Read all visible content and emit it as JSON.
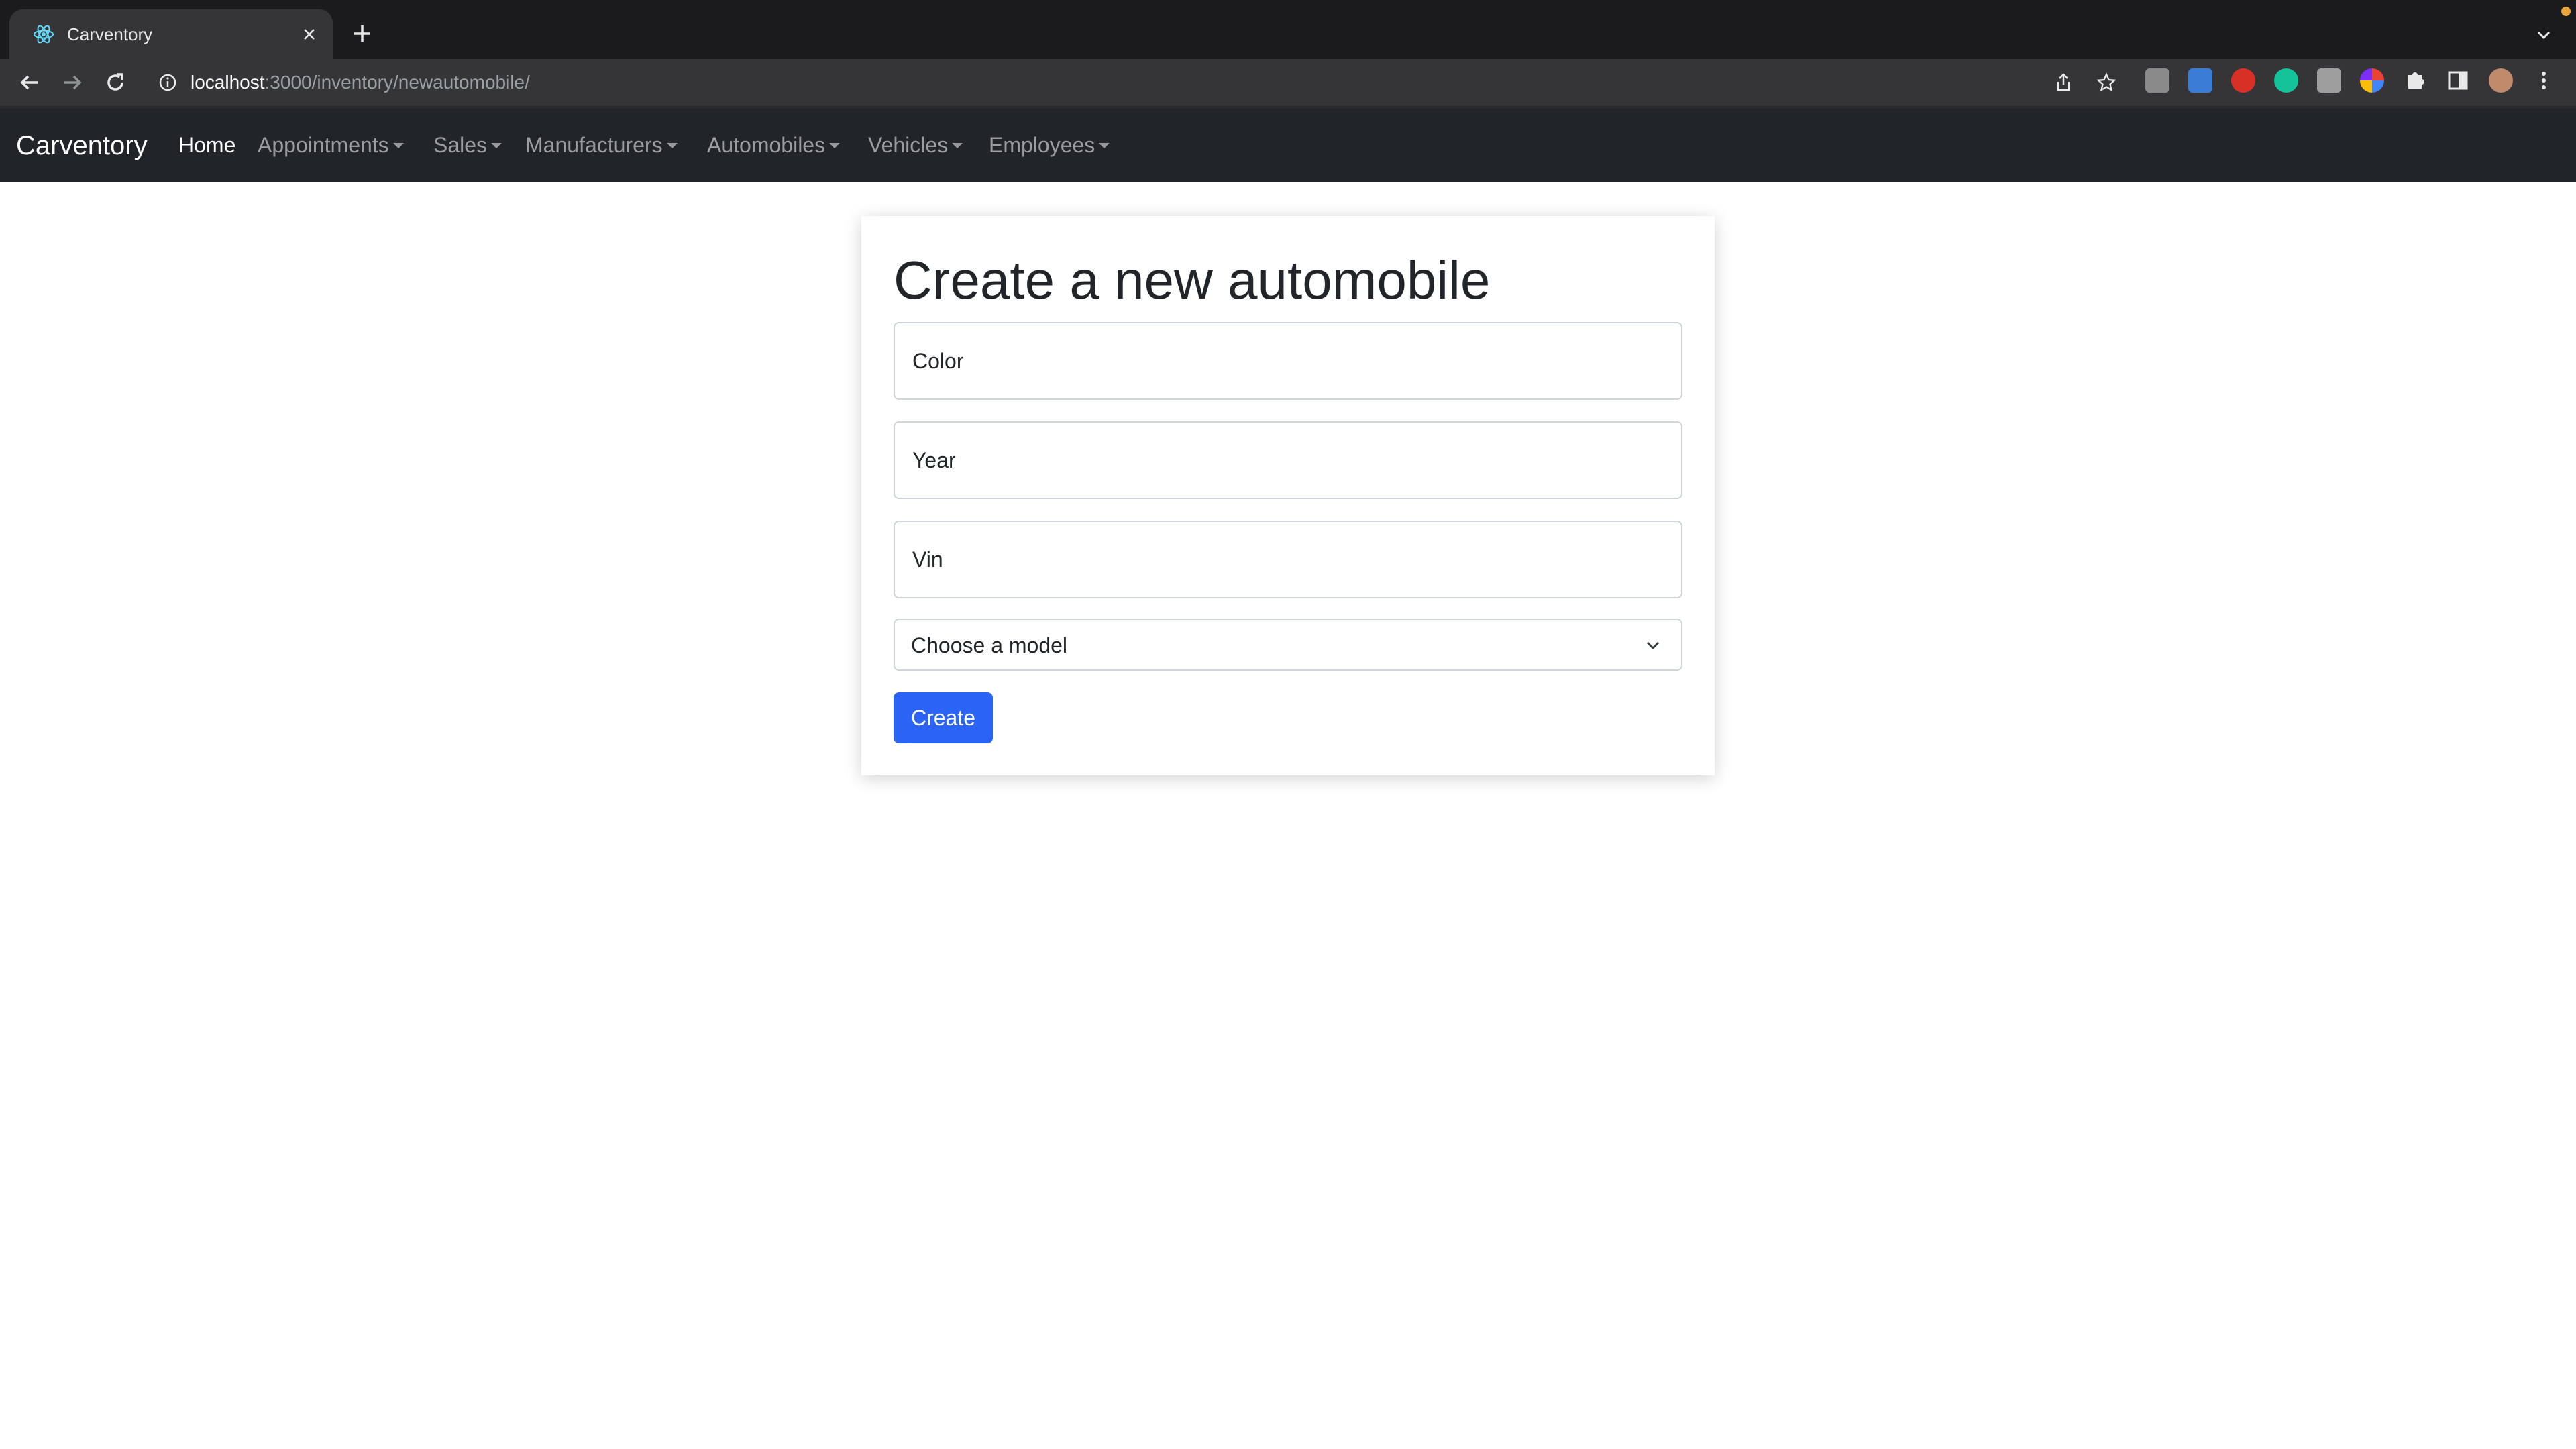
{
  "browser": {
    "tab_title": "Carventory",
    "url_host": "localhost",
    "url_path": ":3000/inventory/newautomobile/"
  },
  "navbar": {
    "brand": "Carventory",
    "items": [
      {
        "label": "Home",
        "active": true,
        "dropdown": false
      },
      {
        "label": "Appointments",
        "active": false,
        "dropdown": true
      },
      {
        "label": "Sales",
        "active": false,
        "dropdown": true
      },
      {
        "label": "Manufacturers",
        "active": false,
        "dropdown": true
      },
      {
        "label": "Automobiles",
        "active": false,
        "dropdown": true
      },
      {
        "label": "Vehicles",
        "active": false,
        "dropdown": true
      },
      {
        "label": "Employees",
        "active": false,
        "dropdown": true
      }
    ]
  },
  "form": {
    "title": "Create a new automobile",
    "color_placeholder": "Color",
    "year_placeholder": "Year",
    "vin_placeholder": "Vin",
    "model_select": "Choose a model",
    "submit_label": "Create"
  },
  "colors": {
    "navbar_bg": "#212529",
    "primary_button": "#2b63f5",
    "browser_chrome": "#353538"
  }
}
